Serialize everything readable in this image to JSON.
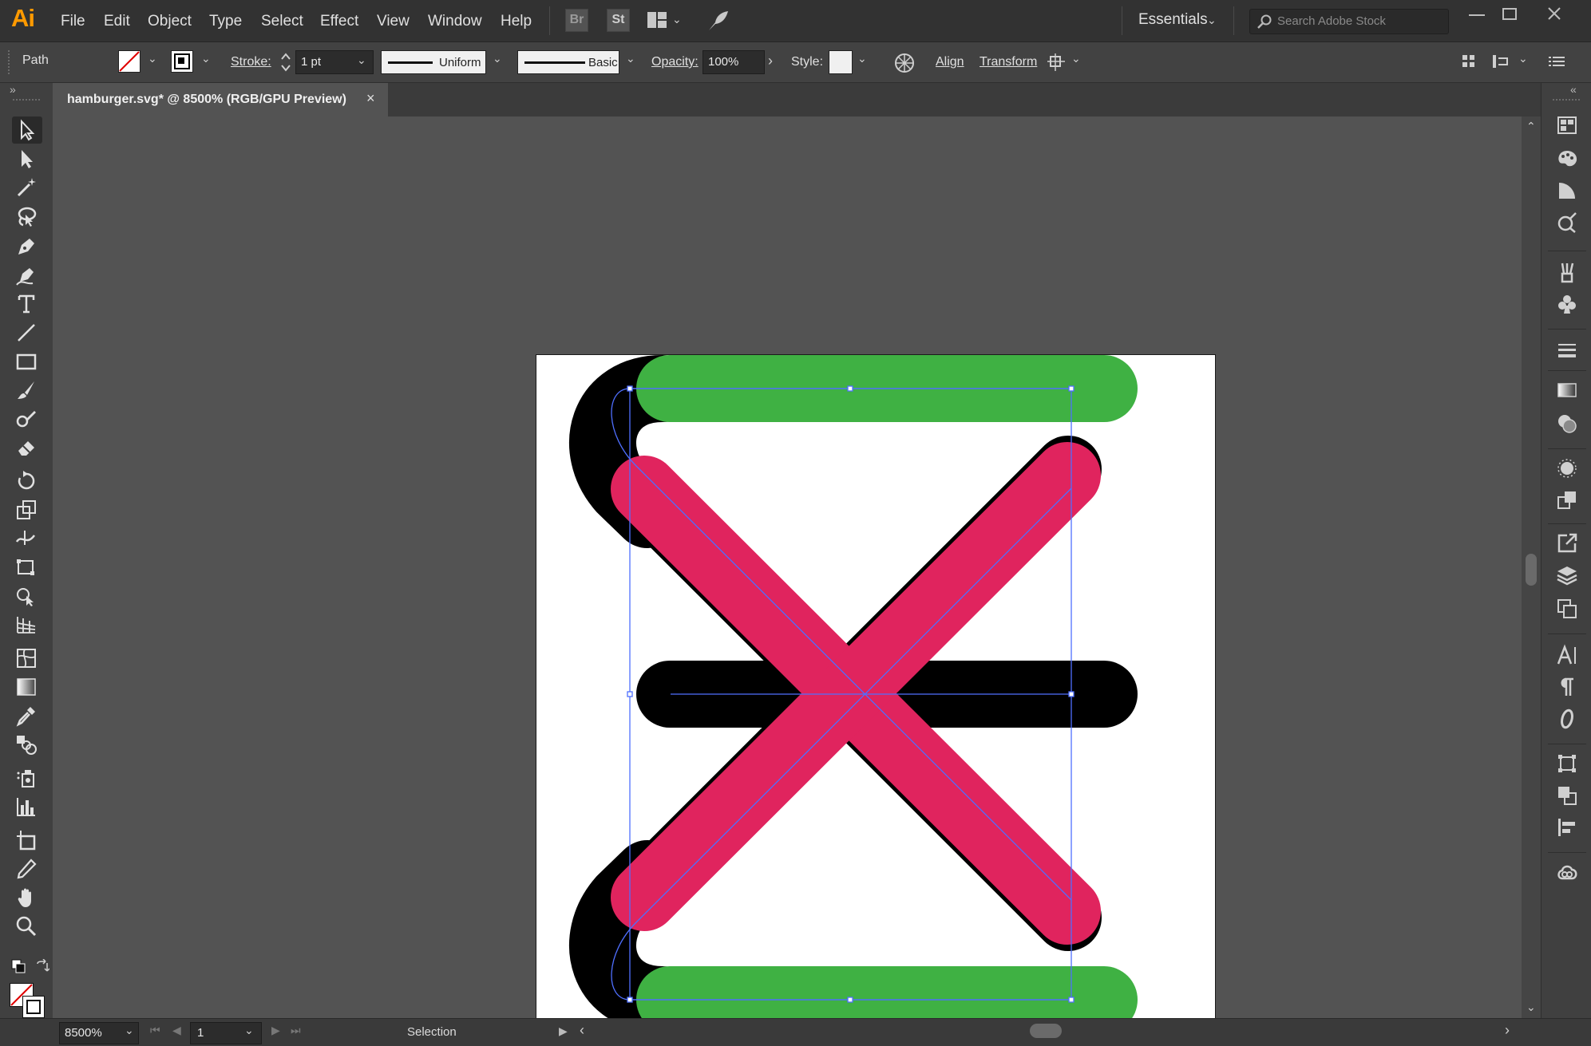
{
  "app": {
    "logo": "Ai"
  },
  "menu": {
    "items": [
      {
        "id": "file",
        "label": "File"
      },
      {
        "id": "edit",
        "label": "Edit"
      },
      {
        "id": "object",
        "label": "Object"
      },
      {
        "id": "type",
        "label": "Type"
      },
      {
        "id": "select",
        "label": "Select"
      },
      {
        "id": "effect",
        "label": "Effect"
      },
      {
        "id": "view",
        "label": "View"
      },
      {
        "id": "window",
        "label": "Window"
      },
      {
        "id": "help",
        "label": "Help"
      }
    ],
    "bridge_label": "Br",
    "stock_label": "St"
  },
  "workspace": {
    "label": "Essentials"
  },
  "search": {
    "placeholder": "Search Adobe Stock"
  },
  "control": {
    "selection_type": "Path",
    "stroke_label": "Stroke:",
    "stroke_weight": "1 pt",
    "variable_width": "Uniform",
    "brush": "Basic",
    "opacity_label": "Opacity:",
    "opacity_value": "100%",
    "style_label": "Style:",
    "align_label": "Align",
    "transform_label": "Transform"
  },
  "document": {
    "tab_title": "hamburger.svg* @ 8500% (RGB/GPU Preview)",
    "close": "×"
  },
  "status": {
    "zoom": "8500%",
    "artboard_number": "1",
    "current_tool": "Selection"
  },
  "colors": {
    "green": "#3fb143",
    "pink": "#e0245e",
    "black": "#000000",
    "selection_blue": "#4f6fff",
    "logo_orange": "#ff9a00"
  }
}
